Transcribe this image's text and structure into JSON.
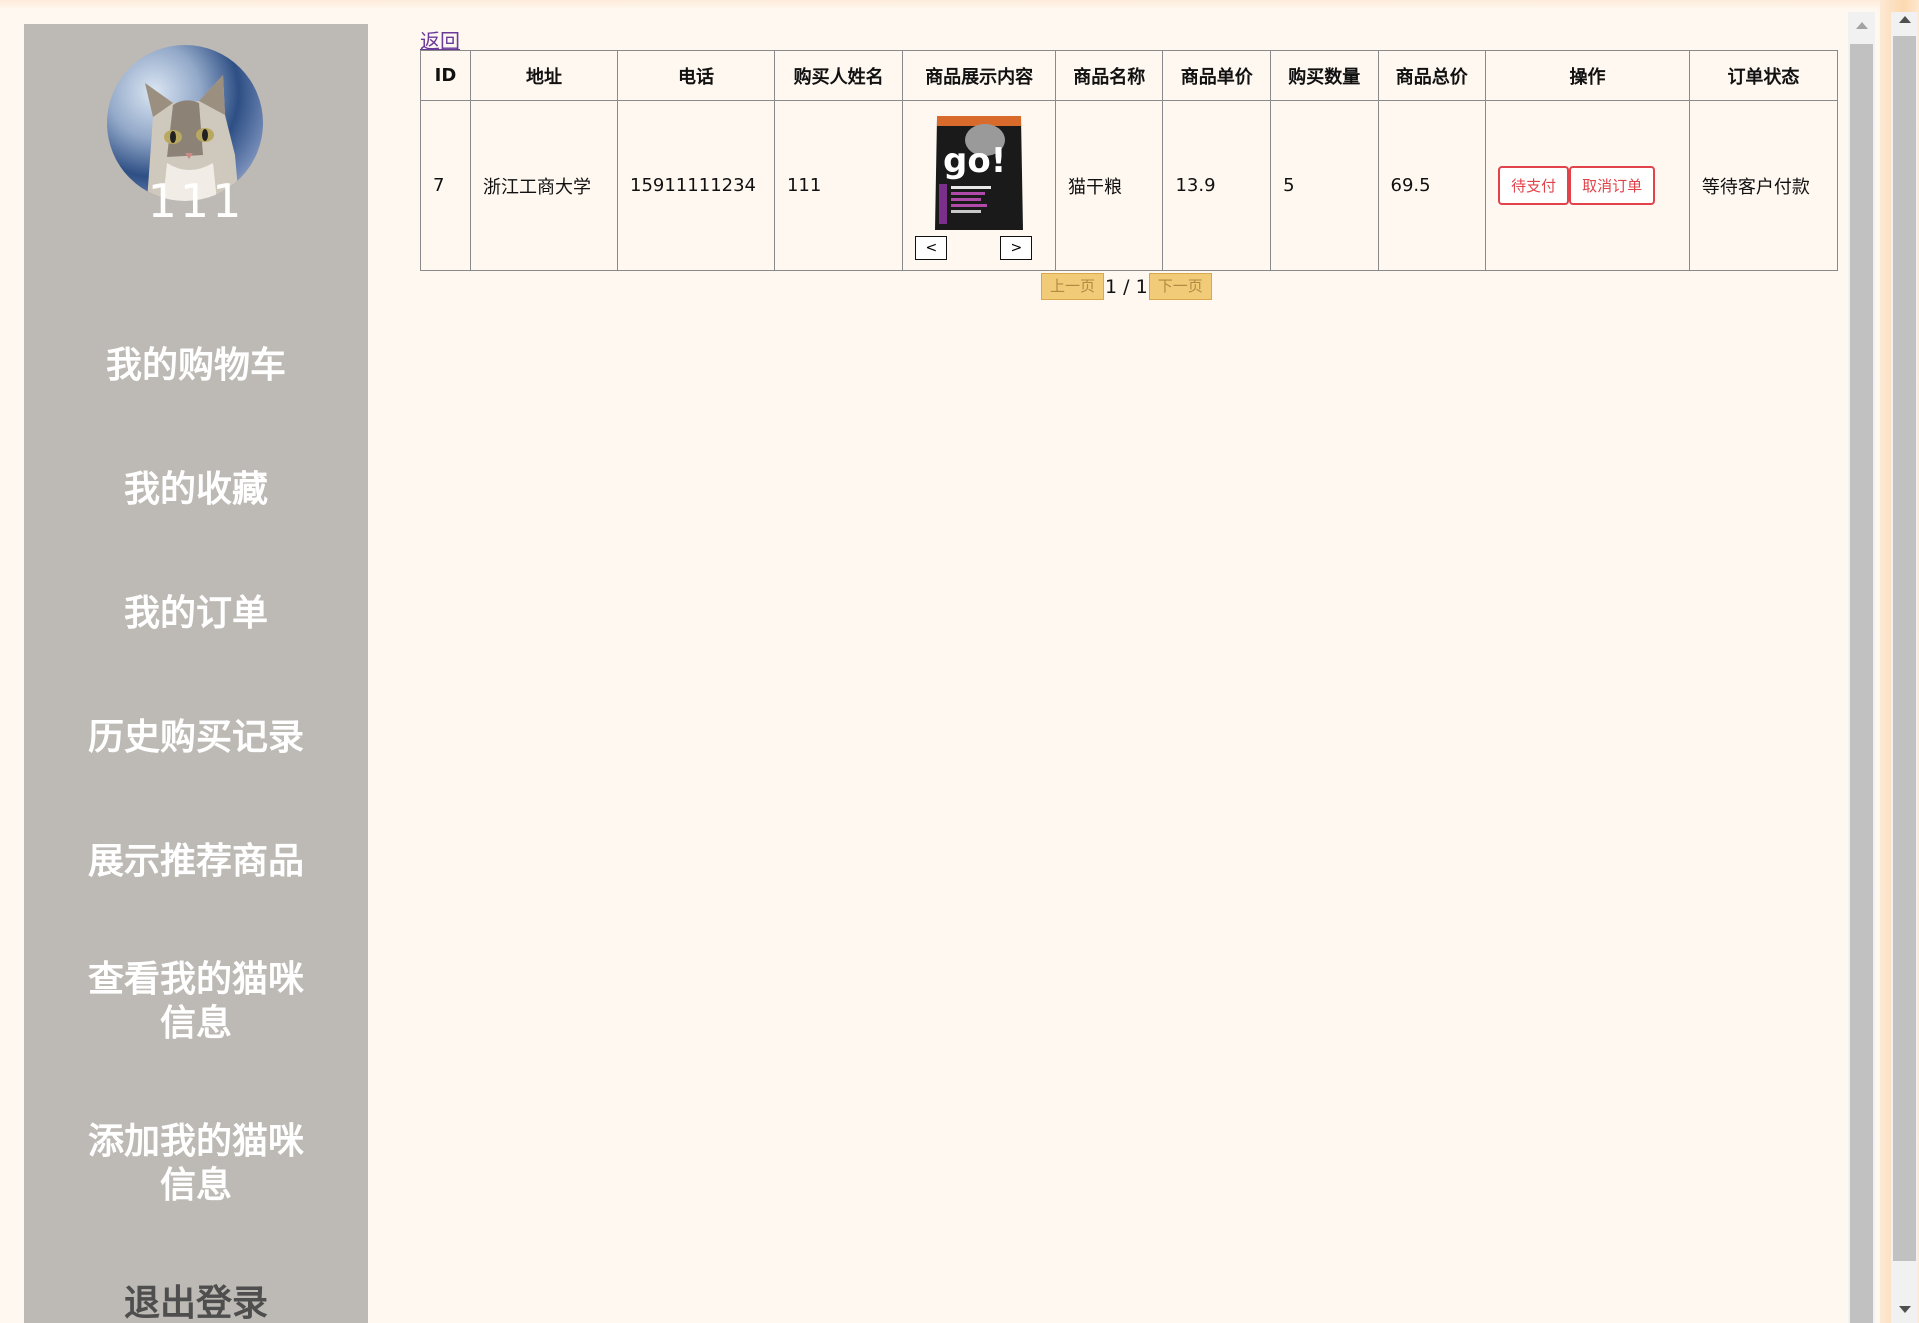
{
  "user": {
    "name": "111"
  },
  "sidebar": {
    "items": [
      {
        "label": "我的购物车"
      },
      {
        "label": "我的收藏"
      },
      {
        "label": "我的订单"
      },
      {
        "label": "历史购买记录"
      },
      {
        "label": "展示推荐商品"
      },
      {
        "label": "查看我的猫咪信息"
      },
      {
        "label": "添加我的猫咪信息"
      },
      {
        "label": "退出登录"
      }
    ]
  },
  "back_label": "返回",
  "table": {
    "headers": [
      "ID",
      "地址",
      "电话",
      "购买人姓名",
      "商品展示内容",
      "商品名称",
      "商品单价",
      "购买数量",
      "商品总价",
      "操作",
      "订单状态"
    ],
    "rows": [
      {
        "id": "7",
        "address": "浙江工商大学",
        "phone": "15911111234",
        "buyer": "111",
        "product_name": "猫干粮",
        "unit_price": "13.9",
        "quantity": "5",
        "total": "69.5",
        "pay_label": "待支付",
        "cancel_label": "取消订单",
        "status": "等待客户付款",
        "image_prev": "<",
        "image_next": ">",
        "image_brand": "go!"
      }
    ]
  },
  "pager": {
    "prev_label": "上一页",
    "info": "1 / 1",
    "next_label": "下一页"
  },
  "colors": {
    "background": "#fff8f1",
    "sidebar": "#bdb9b4",
    "accent_red": "#e2434b",
    "pager": "#f2cb78"
  }
}
